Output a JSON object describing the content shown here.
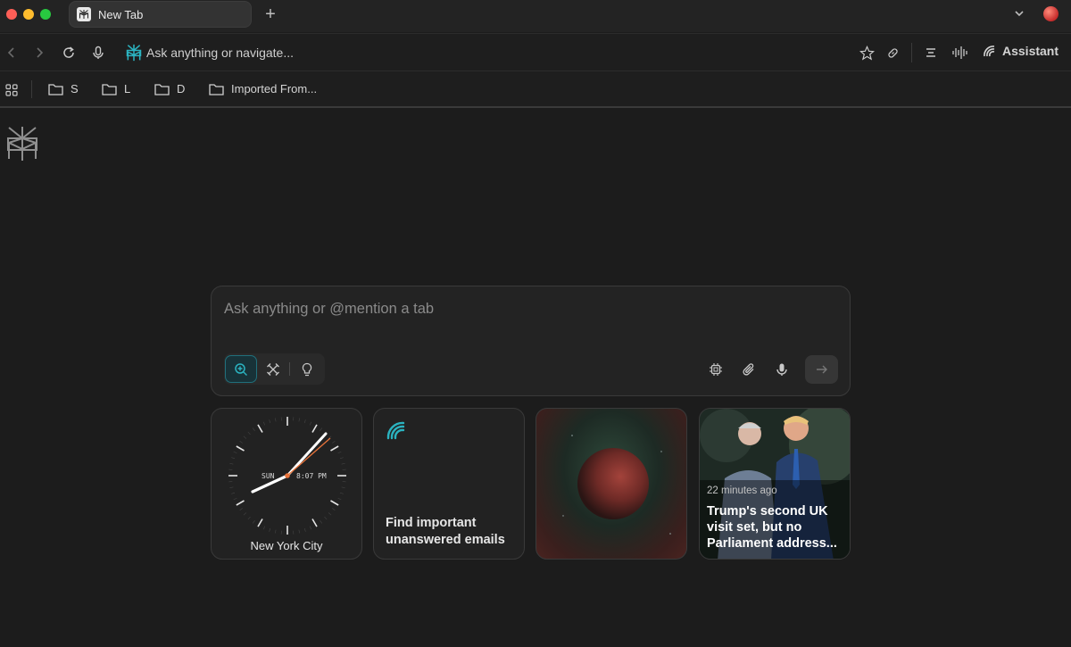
{
  "browser": {
    "tab_title": "New Tab",
    "new_tab_label": "+",
    "omnibox_placeholder": "Ask anything or navigate...",
    "assistant_label": "Assistant"
  },
  "bookmarks": [
    {
      "label": "S"
    },
    {
      "label": "L"
    },
    {
      "label": "D"
    },
    {
      "label": "Imported From..."
    }
  ],
  "composer": {
    "placeholder": "Ask anything or @mention a tab",
    "modes": [
      "search-icon",
      "research-icon",
      "lightbulb-icon"
    ],
    "active_mode": "search"
  },
  "cards": {
    "clock": {
      "day": "SUN",
      "time": "8:07 PM",
      "city": "New York City"
    },
    "email": {
      "text_line1": "Find important",
      "text_line2": "unanswered emails"
    },
    "news": {
      "time_ago": "22 minutes ago",
      "headline": "Trump's second UK visit set, but no Parliament address..."
    }
  },
  "colors": {
    "accent": "#2bb3c0",
    "background": "#1c1c1c",
    "clock_second_hand": "#e8733a"
  }
}
